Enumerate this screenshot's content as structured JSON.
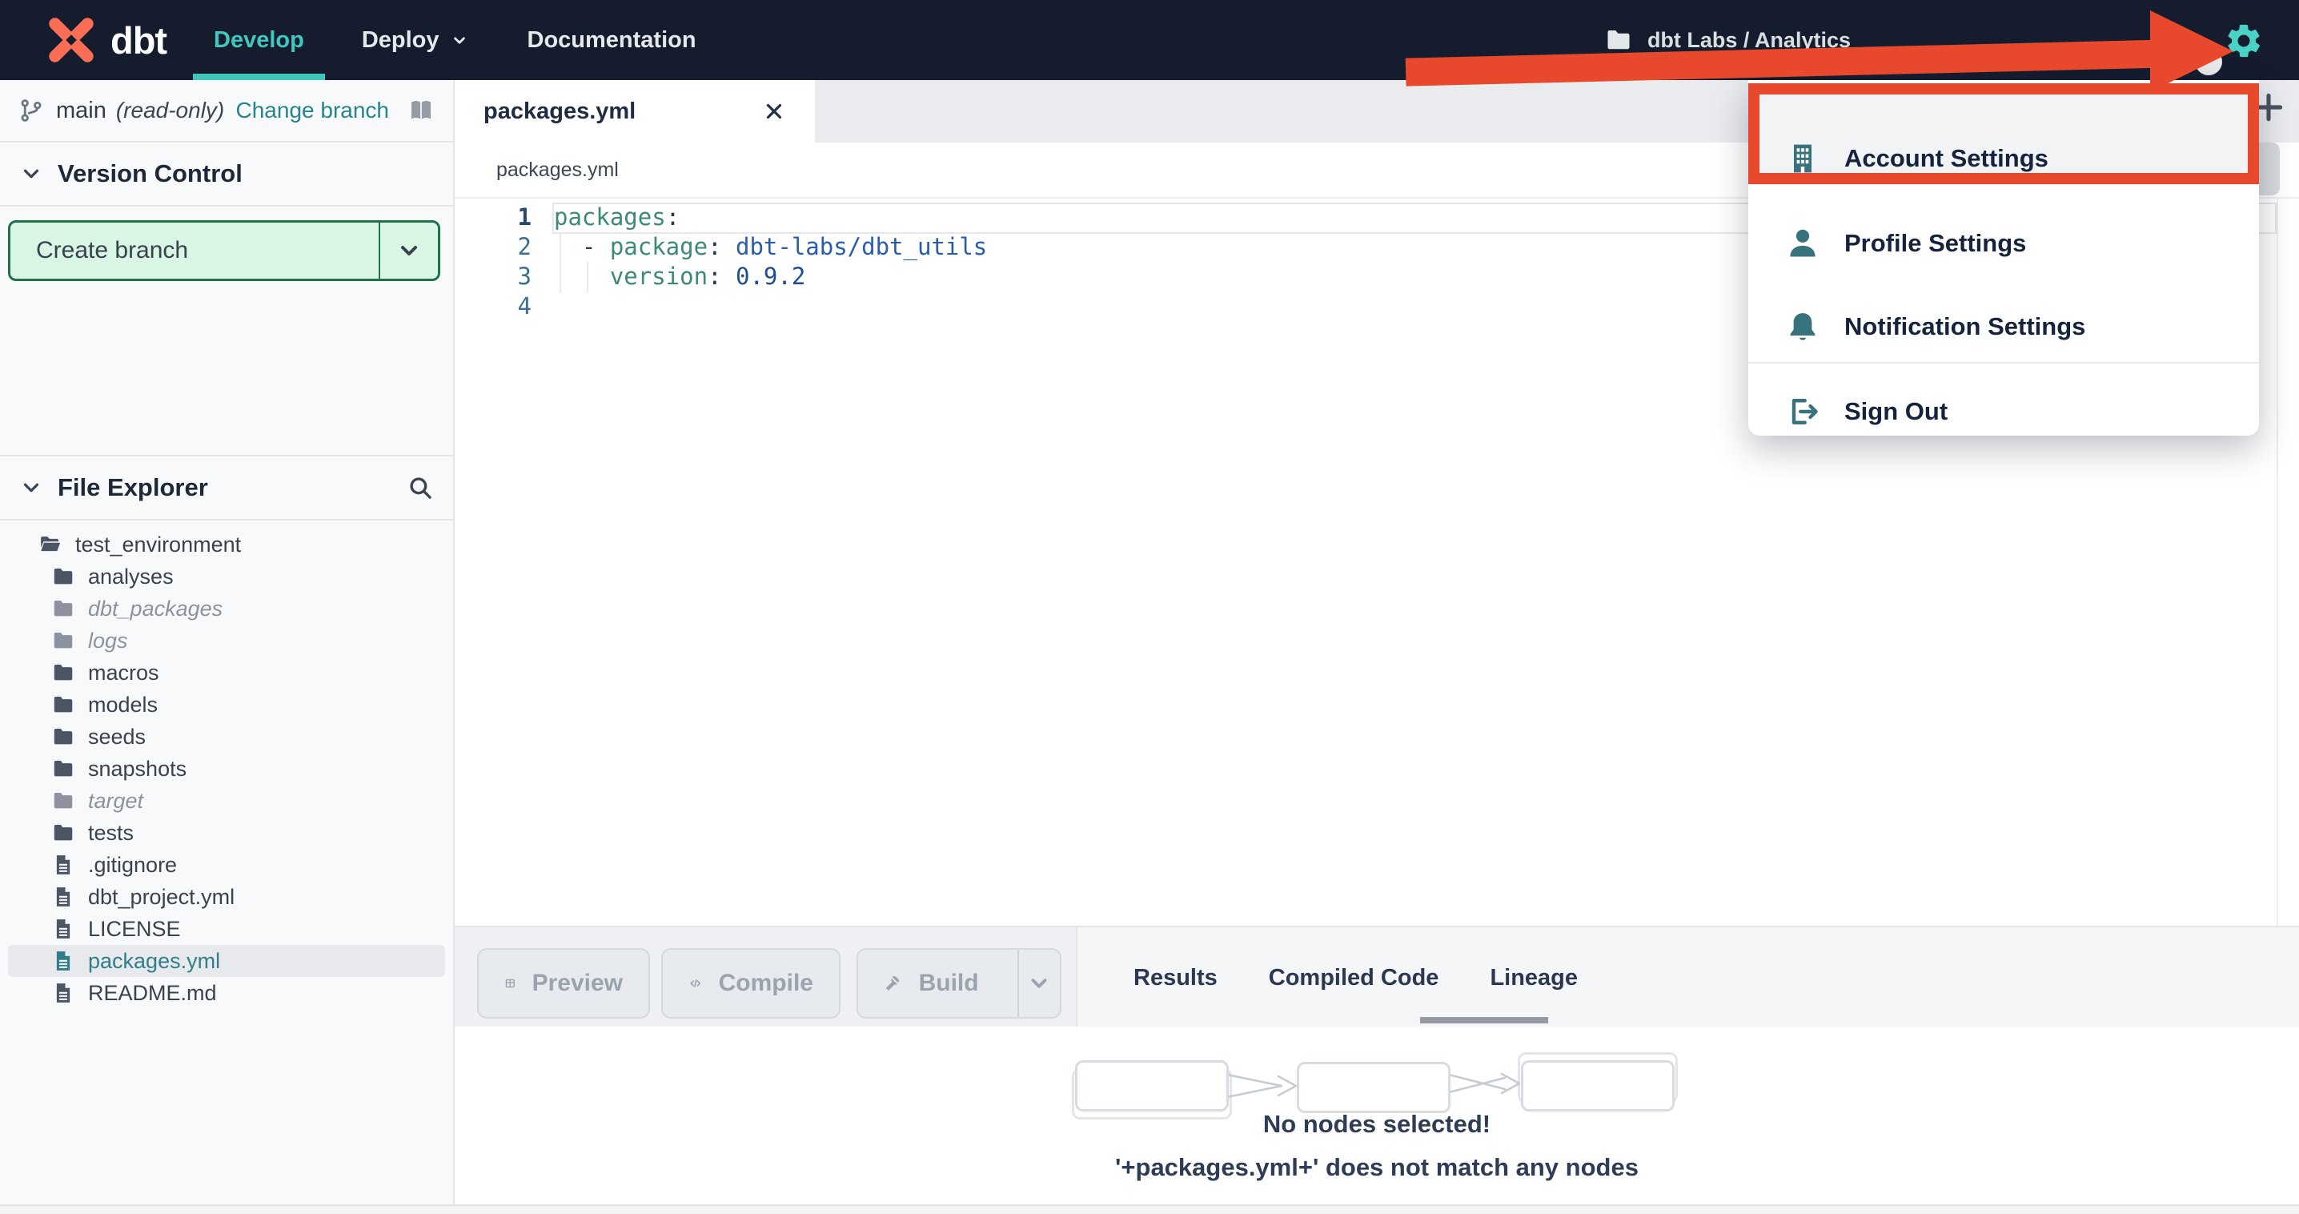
{
  "colors": {
    "navbar_bg": "#141c2e",
    "accent_teal": "#3fc6bd",
    "gear_teal": "#4bd2c6",
    "annotation_red": "#e8492c",
    "create_branch_bg": "#d9f6e5",
    "create_branch_border": "#20714a",
    "link_teal": "#27848d",
    "menu_icon_teal": "#38727c",
    "code_key": "#3d8a74",
    "code_value": "#2a5ca8"
  },
  "navbar": {
    "brand": "dbt",
    "items": [
      {
        "label": "Develop",
        "active": true,
        "caret": false
      },
      {
        "label": "Deploy",
        "active": false,
        "caret": true
      },
      {
        "label": "Documentation",
        "active": false,
        "caret": false
      }
    ],
    "account": "dbt Labs / Analytics"
  },
  "account_menu": {
    "items": [
      {
        "label": "Account Settings",
        "icon": "building-icon",
        "highlighted": true
      },
      {
        "label": "Profile Settings",
        "icon": "person-icon",
        "highlighted": false
      },
      {
        "label": "Notification Settings",
        "icon": "bell-icon",
        "highlighted": false
      },
      {
        "label": "Sign Out",
        "icon": "sign-out-icon",
        "highlighted": false,
        "divider_before": true
      }
    ]
  },
  "sidebar": {
    "branch": {
      "name": "main",
      "mode": "(read-only)",
      "change_label": "Change branch"
    },
    "version_control": {
      "title": "Version Control",
      "create_branch_label": "Create branch"
    },
    "file_explorer": {
      "title": "File Explorer",
      "tree": [
        {
          "name": "test_environment",
          "type": "folder-open",
          "level": 0,
          "muted": false,
          "selected": false
        },
        {
          "name": "analyses",
          "type": "folder",
          "level": 1,
          "muted": false,
          "selected": false
        },
        {
          "name": "dbt_packages",
          "type": "folder",
          "level": 1,
          "muted": true,
          "selected": false
        },
        {
          "name": "logs",
          "type": "folder",
          "level": 1,
          "muted": true,
          "selected": false
        },
        {
          "name": "macros",
          "type": "folder",
          "level": 1,
          "muted": false,
          "selected": false
        },
        {
          "name": "models",
          "type": "folder",
          "level": 1,
          "muted": false,
          "selected": false
        },
        {
          "name": "seeds",
          "type": "folder",
          "level": 1,
          "muted": false,
          "selected": false
        },
        {
          "name": "snapshots",
          "type": "folder",
          "level": 1,
          "muted": false,
          "selected": false
        },
        {
          "name": "target",
          "type": "folder",
          "level": 1,
          "muted": true,
          "selected": false
        },
        {
          "name": "tests",
          "type": "folder",
          "level": 1,
          "muted": false,
          "selected": false
        },
        {
          "name": ".gitignore",
          "type": "file",
          "level": 1,
          "muted": false,
          "selected": false
        },
        {
          "name": "dbt_project.yml",
          "type": "file",
          "level": 1,
          "muted": false,
          "selected": false
        },
        {
          "name": "LICENSE",
          "type": "file",
          "level": 1,
          "muted": false,
          "selected": false
        },
        {
          "name": "packages.yml",
          "type": "file",
          "level": 1,
          "muted": false,
          "selected": true
        },
        {
          "name": "README.md",
          "type": "file",
          "level": 1,
          "muted": false,
          "selected": false
        }
      ]
    }
  },
  "editor": {
    "tab": {
      "label": "packages.yml"
    },
    "breadcrumb": "packages.yml",
    "code": {
      "lines": [
        {
          "num": "1",
          "active": true,
          "tokens": [
            {
              "t": "key",
              "s": "packages"
            },
            {
              "t": "punc",
              "s": ":"
            }
          ]
        },
        {
          "num": "2",
          "active": false,
          "tokens": [
            {
              "t": "punc",
              "s": "  - "
            },
            {
              "t": "key",
              "s": "package"
            },
            {
              "t": "punc",
              "s": ": "
            },
            {
              "t": "val",
              "s": "dbt-labs/dbt_utils"
            }
          ]
        },
        {
          "num": "3",
          "active": false,
          "tokens": [
            {
              "t": "punc",
              "s": "    "
            },
            {
              "t": "key",
              "s": "version"
            },
            {
              "t": "punc",
              "s": ": "
            },
            {
              "t": "num",
              "s": "0.9.2"
            }
          ]
        },
        {
          "num": "4",
          "active": false,
          "tokens": []
        }
      ]
    }
  },
  "panel": {
    "buttons": [
      {
        "label": "Preview",
        "icon": "table-icon",
        "split": false
      },
      {
        "label": "Compile",
        "icon": "code-icon",
        "split": false
      },
      {
        "label": "Build",
        "icon": "hammer-icon",
        "split": true
      }
    ],
    "tabs": [
      {
        "label": "Results",
        "active": false
      },
      {
        "label": "Compiled Code",
        "active": false
      },
      {
        "label": "Lineage",
        "active": true
      }
    ],
    "lineage": {
      "message_title": "No nodes selected!",
      "message_detail": "'+packages.yml+' does not match any nodes"
    }
  }
}
